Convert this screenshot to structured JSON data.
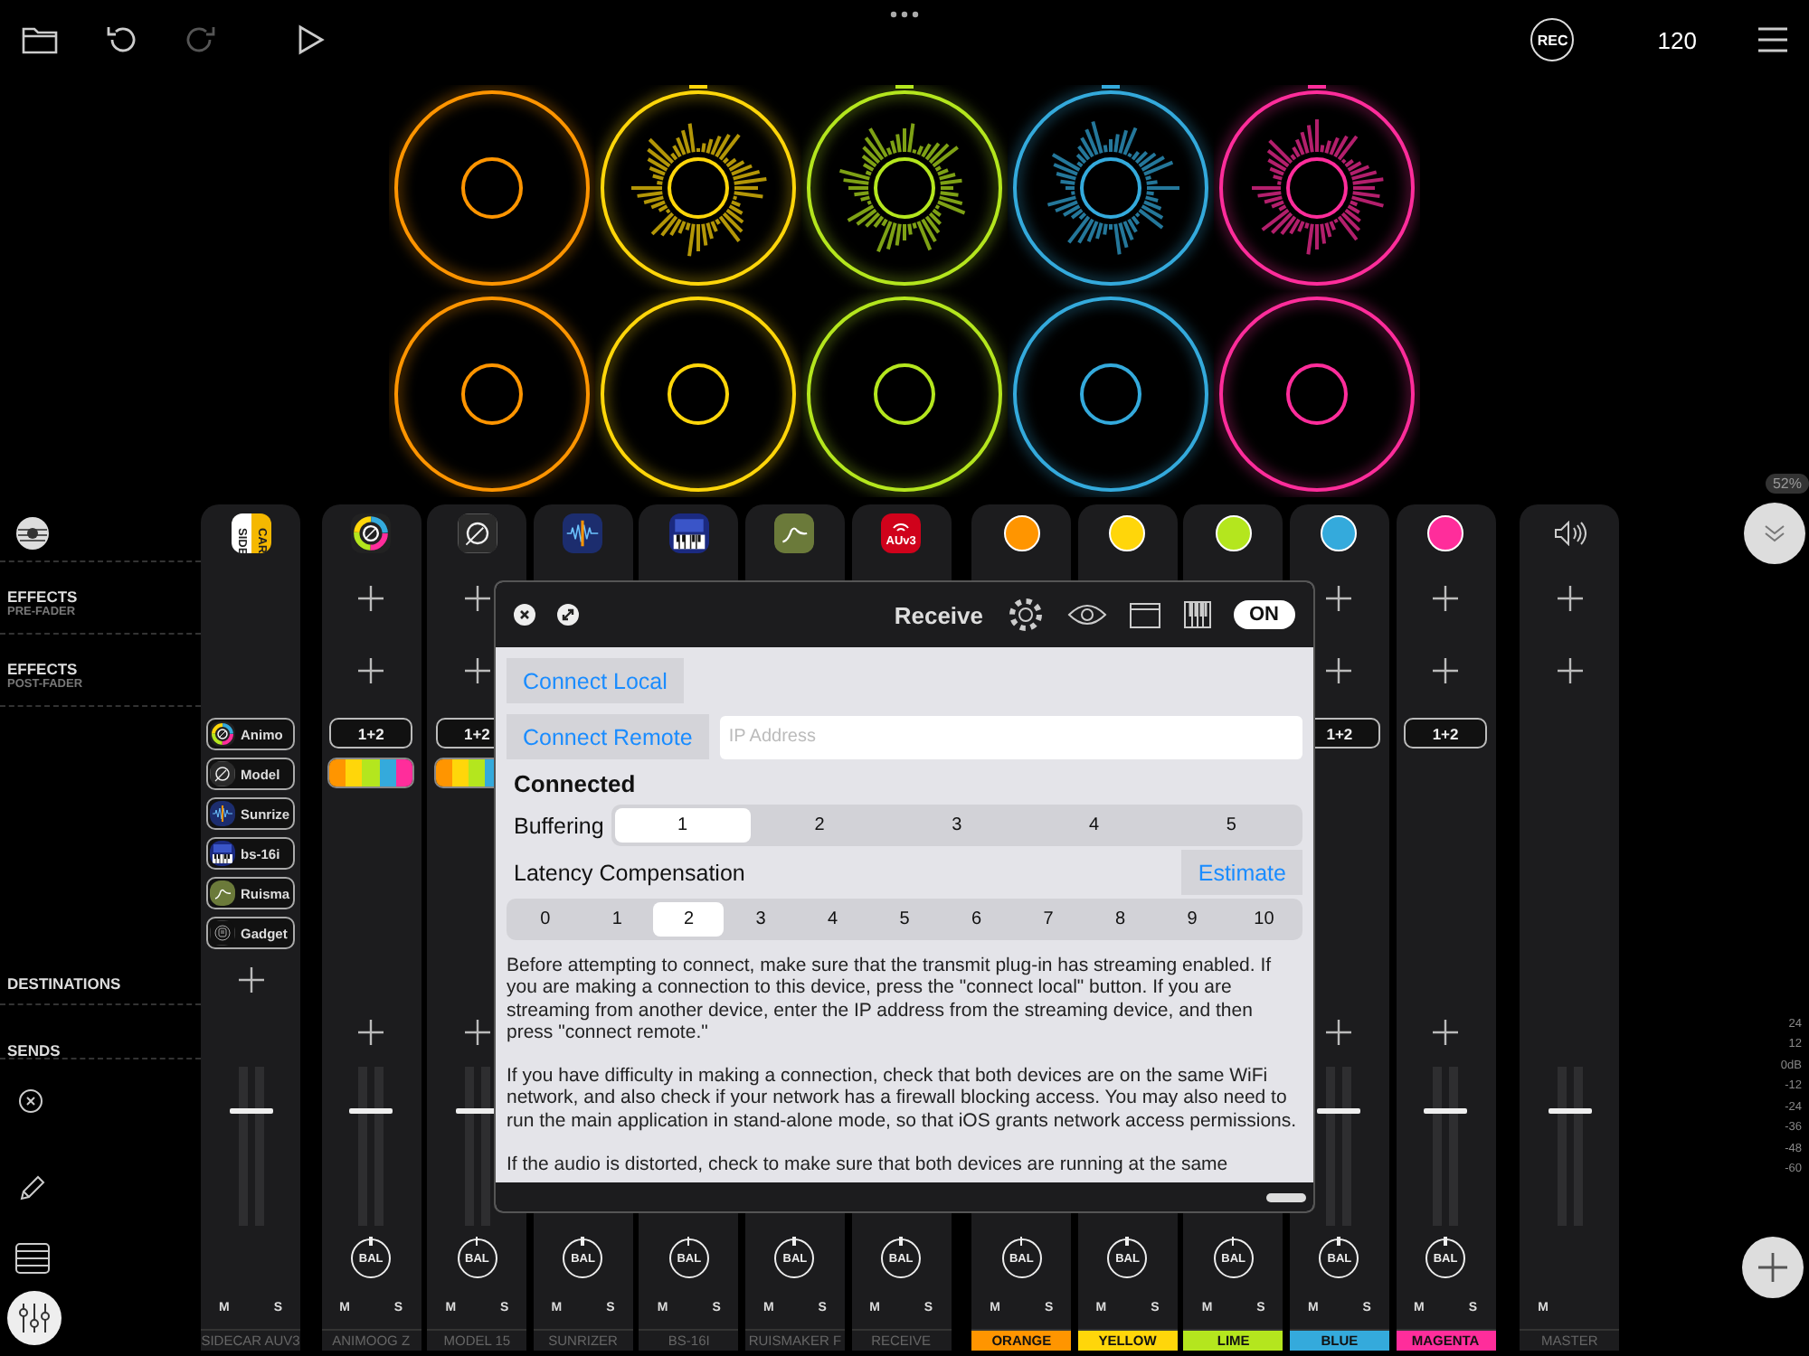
{
  "toolbar": {
    "redo_disabled": true,
    "rec": "REC",
    "tempo": "120"
  },
  "pads": [
    [
      {
        "color": "#ff9500",
        "playing": false
      },
      {
        "color": "#ffd60a",
        "playing": true
      },
      {
        "color": "#b4e61e",
        "playing": true
      },
      {
        "color": "#34aadc",
        "playing": true
      },
      {
        "color": "#ff2d9b",
        "playing": true
      }
    ],
    [
      {
        "color": "#ff9500",
        "playing": false
      },
      {
        "color": "#ffd60a",
        "playing": false
      },
      {
        "color": "#b4e61e",
        "playing": false
      },
      {
        "color": "#34aadc",
        "playing": false
      },
      {
        "color": "#ff2d9b",
        "playing": false
      }
    ]
  ],
  "cpu": "52%",
  "row_labels": [
    {
      "title": "EFFECTS",
      "subtitle": "PRE-FADER"
    },
    {
      "title": "EFFECTS",
      "subtitle": "POST-FADER"
    },
    {
      "title": "DESTINATIONS"
    },
    {
      "title": "SENDS"
    }
  ],
  "channels": [
    {
      "name": "SIDECAR AUV3",
      "kind": "sidecar",
      "icon_text": [
        "SIDE",
        "CAR"
      ],
      "plugins": [
        {
          "kind": "animoog",
          "name": "Animo"
        },
        {
          "kind": "model",
          "name": "Model"
        },
        {
          "kind": "sunrizer",
          "name": "Sunrize"
        },
        {
          "kind": "bs16i",
          "name": "bs-16i"
        },
        {
          "kind": "ruismaker",
          "name": "Ruisma"
        },
        {
          "kind": "gadget",
          "name": "Gadget"
        }
      ],
      "add_destination": true,
      "level": 0.73,
      "mute": "M",
      "solo": "S"
    },
    {
      "name": "ANIMOOG Z",
      "kind": "animoog",
      "effects_pre": true,
      "effects_post": true,
      "destination": "1+2",
      "routing_colors": [
        {
          "color": "#ff9500"
        },
        {
          "color": "#ffd60a"
        },
        {
          "color": "#b4e61e"
        },
        {
          "color": "#34aadc"
        },
        {
          "color": "#ff2d9b"
        }
      ],
      "add_send": true,
      "level": 0.73,
      "balance": "BAL",
      "mute": "M",
      "solo": "S"
    },
    {
      "name": "MODEL 15",
      "kind": "model",
      "effects_pre": true,
      "effects_post": true,
      "destination": "1+2",
      "routing_colors": [
        {
          "color": "#ff9500"
        },
        {
          "color": "#ffd60a"
        },
        {
          "color": "#b4e61e"
        },
        {
          "color": "#34aadc"
        }
      ],
      "add_send": true,
      "level": 0.73,
      "balance": "BAL",
      "mute": "M",
      "solo": "S"
    },
    {
      "name": "SUNRIZER",
      "kind": "sunrizer",
      "balance": "BAL",
      "mute": "M",
      "solo": "S"
    },
    {
      "name": "BS-16I",
      "kind": "bs16i",
      "balance": "BAL",
      "mute": "M",
      "solo": "S"
    },
    {
      "name": "RUISMAKER F",
      "kind": "ruismaker",
      "balance": "BAL",
      "mute": "M",
      "solo": "S"
    },
    {
      "name": "RECEIVE",
      "kind": "auv3",
      "icon_text": [
        "AUv3"
      ],
      "balance": "BAL",
      "mute": "M",
      "solo": "S"
    },
    {
      "name": "ORANGE",
      "kind": "dot",
      "color": "#ff9500",
      "balance": "BAL",
      "mute": "M",
      "solo": "S"
    },
    {
      "name": "YELLOW",
      "kind": "dot",
      "color": "#ffd60a",
      "balance": "BAL",
      "mute": "M",
      "solo": "S"
    },
    {
      "name": "LIME",
      "kind": "dot",
      "color": "#b4e61e",
      "balance": "BAL",
      "mute": "M",
      "solo": "S"
    },
    {
      "name": "BLUE",
      "kind": "dot",
      "color": "#34aadc",
      "effects_pre": true,
      "effects_post": true,
      "destination": "1+2",
      "add_send": true,
      "level": 0.73,
      "balance": "BAL",
      "mute": "M",
      "solo": "S"
    },
    {
      "name": "MAGENTA",
      "kind": "dot",
      "color": "#ff2d9b",
      "effects_pre": true,
      "effects_post": true,
      "destination": "1+2",
      "add_send": true,
      "level": 0.73,
      "balance": "BAL",
      "mute": "M",
      "solo": "S"
    },
    {
      "name": "MASTER",
      "kind": "speaker",
      "effects_pre": true,
      "effects_post": true,
      "level": 0.73,
      "mute": "M"
    }
  ],
  "scale": [
    "24",
    "12",
    "0dB",
    "-12",
    "-24",
    "-36",
    "-48",
    "-60"
  ],
  "dialog": {
    "title": "Receive",
    "on": true,
    "toggle": "ON",
    "connect_local": "Connect Local",
    "connect_remote": "Connect Remote",
    "ip_placeholder": "IP Address",
    "status": "Connected",
    "buffering": {
      "label": "Buffering",
      "options": [
        {
          "label": "1",
          "selected": true
        },
        {
          "label": "2",
          "selected": false
        },
        {
          "label": "3",
          "selected": false
        },
        {
          "label": "4",
          "selected": false
        },
        {
          "label": "5",
          "selected": false
        }
      ]
    },
    "latency": {
      "label": "Latency Compensation",
      "button": "Estimate",
      "options": [
        {
          "label": "0",
          "selected": false
        },
        {
          "label": "1",
          "selected": false
        },
        {
          "label": "2",
          "selected": true
        },
        {
          "label": "3",
          "selected": false
        },
        {
          "label": "4",
          "selected": false
        },
        {
          "label": "5",
          "selected": false
        },
        {
          "label": "6",
          "selected": false
        },
        {
          "label": "7",
          "selected": false
        },
        {
          "label": "8",
          "selected": false
        },
        {
          "label": "9",
          "selected": false
        },
        {
          "label": "10",
          "selected": false
        }
      ]
    },
    "paragraphs": [
      "Before attempting to connect, make sure that the transmit plug-in has streaming enabled. If you are making a connection to this device, press the \"connect local\" button.  If you are streaming from another device, enter the IP address from the streaming device, and then press \"connect remote.\"",
      "If you have difficulty in making a connection, check that both devices are on the same WiFi network, and also check if your network has a firewall blocking access.  You may also need to run the main application in stand-alone mode, so that iOS grants network access permissions.",
      "If the audio is distorted, check to make sure that both devices are running at the same"
    ]
  }
}
